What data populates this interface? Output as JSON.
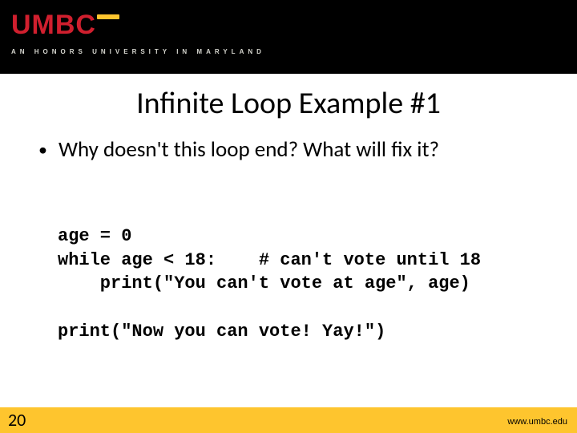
{
  "header": {
    "logo": "UMBC",
    "tagline": "AN HONORS UNIVERSITY IN MARYLAND"
  },
  "title": "Infinite Loop Example #1",
  "bullet": "Why doesn't this loop end?  What will fix it?",
  "code": {
    "l1": "age = 0",
    "l2": "while age < 18:    # can't vote until 18",
    "l3": "    print(\"You can't vote at age\", age)",
    "l4": "",
    "l5": "print(\"Now you can vote! Yay!\")"
  },
  "footer": {
    "page": "20",
    "url": "www.umbc.edu"
  }
}
